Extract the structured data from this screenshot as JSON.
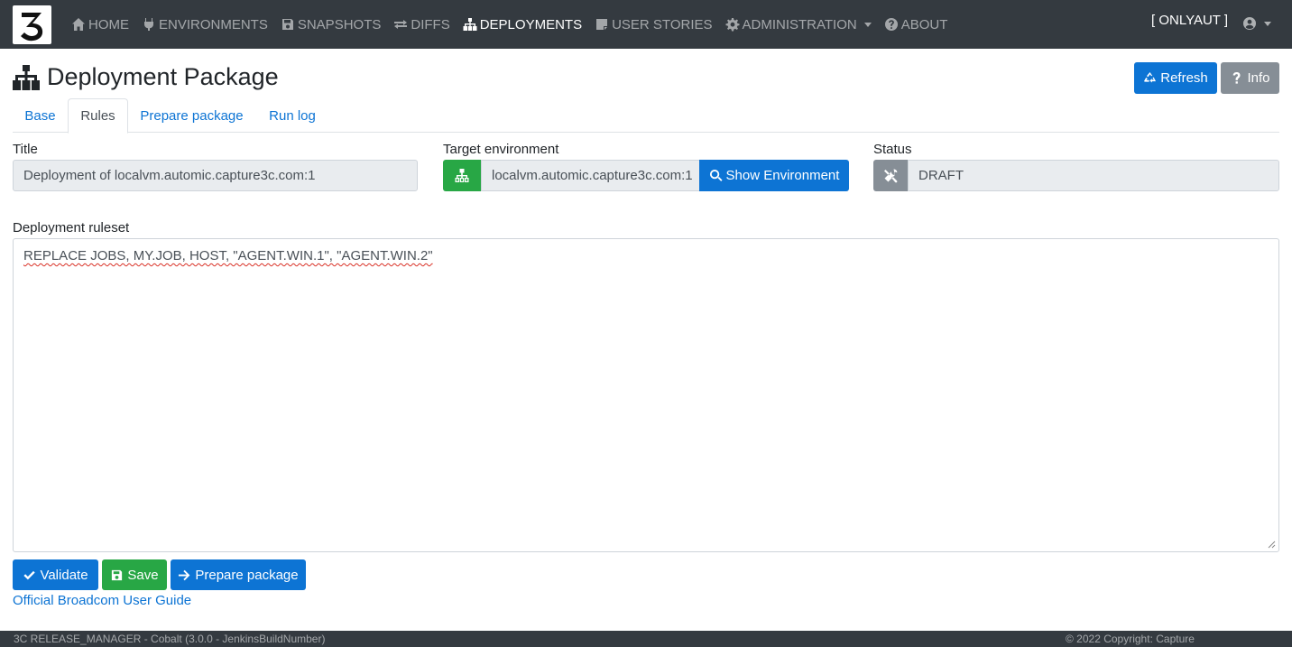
{
  "app": {
    "logo_icon": "capture-3c-logo-icon"
  },
  "nav": {
    "items": [
      {
        "label": "HOME",
        "icon": "home-icon"
      },
      {
        "label": "ENVIRONMENTS",
        "icon": "plug-icon"
      },
      {
        "label": "SNAPSHOTS",
        "icon": "save-icon"
      },
      {
        "label": "DIFFS",
        "icon": "exchange-icon"
      },
      {
        "label": "DEPLOYMENTS",
        "icon": "sitemap-icon",
        "active": true
      },
      {
        "label": "USER STORIES",
        "icon": "sticky-note-icon"
      },
      {
        "label": "ADMINISTRATION",
        "icon": "gear-icon",
        "dropdown": true
      },
      {
        "label": "ABOUT",
        "icon": "question-circle-icon"
      }
    ],
    "user_label": "[ ONLYAUT ]",
    "user_icon": "user-circle-icon"
  },
  "header": {
    "title": "Deployment Package",
    "title_icon": "sitemap-icon",
    "refresh_label": "Refresh",
    "info_label": "Info"
  },
  "tabs": [
    {
      "label": "Base"
    },
    {
      "label": "Rules",
      "active": true
    },
    {
      "label": "Prepare package"
    },
    {
      "label": "Run log"
    }
  ],
  "form": {
    "title_label": "Title",
    "title_value": "Deployment of localvm.automic.capture3c.com:1",
    "target_label": "Target environment",
    "target_value": "localvm.automic.capture3c.com:1",
    "show_env_label": "Show Environment",
    "status_label": "Status",
    "status_value": "DRAFT",
    "ruleset_label": "Deployment ruleset",
    "ruleset_value": "REPLACE JOBS, MY.JOB, HOST, \"AGENT.WIN.1\", \"AGENT.WIN.2\""
  },
  "actions": {
    "validate_label": "Validate",
    "save_label": "Save",
    "prepare_label": "Prepare package",
    "guide_link": "Official Broadcom User Guide"
  },
  "footer": {
    "left": "3C RELEASE_MANAGER - Cobalt (3.0.0 - JenkinsBuildNumber)",
    "right": "© 2022 Copyright: Capture"
  },
  "colors": {
    "navbar": "#343a40",
    "primary": "#0d74d4",
    "success": "#28a745",
    "secondary": "#868e96"
  }
}
